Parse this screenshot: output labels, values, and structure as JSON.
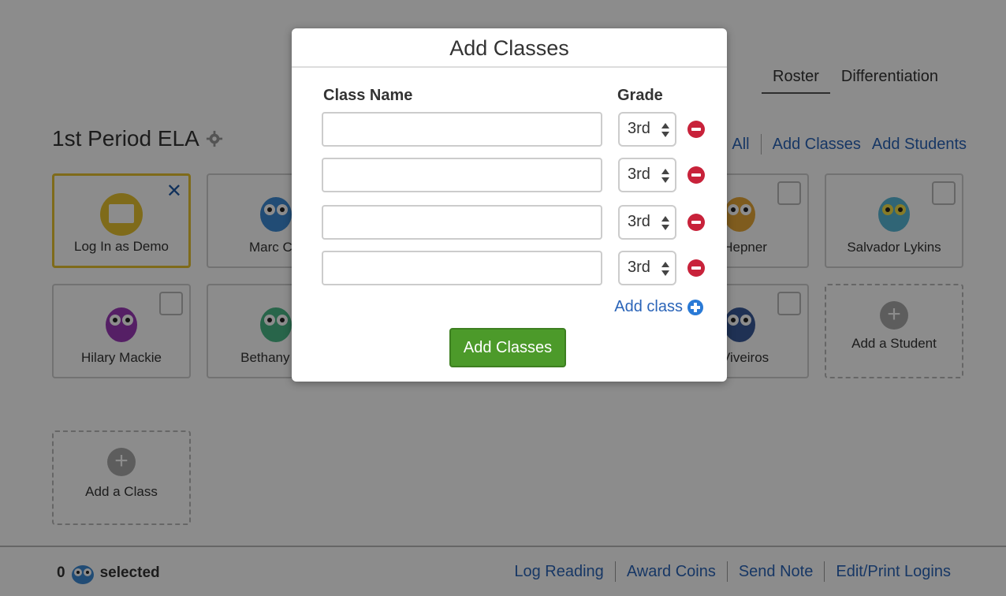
{
  "tabs": [
    {
      "label": "Roster",
      "active": true
    },
    {
      "label": "Differentiation",
      "active": false
    }
  ],
  "class_title": "1st Period ELA",
  "action_links": {
    "all": "All",
    "add_classes": "Add Classes",
    "add_students": "Add Students"
  },
  "cards": {
    "demo": "Log In as Demo",
    "students": [
      "Marc Clo",
      "d Hepner",
      "Salvador Lykins",
      "Hilary Mackie",
      "Bethany Mc",
      "n Viveiros"
    ],
    "add_student": "Add a Student",
    "add_class": "Add a Class"
  },
  "bottom": {
    "count": "0",
    "selected_label": "selected",
    "links": [
      "Log Reading",
      "Award Coins",
      "Send Note",
      "Edit/Print Logins"
    ]
  },
  "modal": {
    "title": "Add Classes",
    "col_class_name": "Class Name",
    "col_grade": "Grade",
    "rows": [
      {
        "class_name": "",
        "grade": "3rd"
      },
      {
        "class_name": "",
        "grade": "3rd"
      },
      {
        "class_name": "",
        "grade": "3rd"
      },
      {
        "class_name": "",
        "grade": "3rd"
      }
    ],
    "add_class_link": "Add class",
    "submit_label": "Add Classes"
  },
  "colors": {
    "link_blue": "#2a64b8",
    "submit_green": "#4c9a2a",
    "remove_red": "#c8223a",
    "demo_yellow": "#e8c430"
  }
}
